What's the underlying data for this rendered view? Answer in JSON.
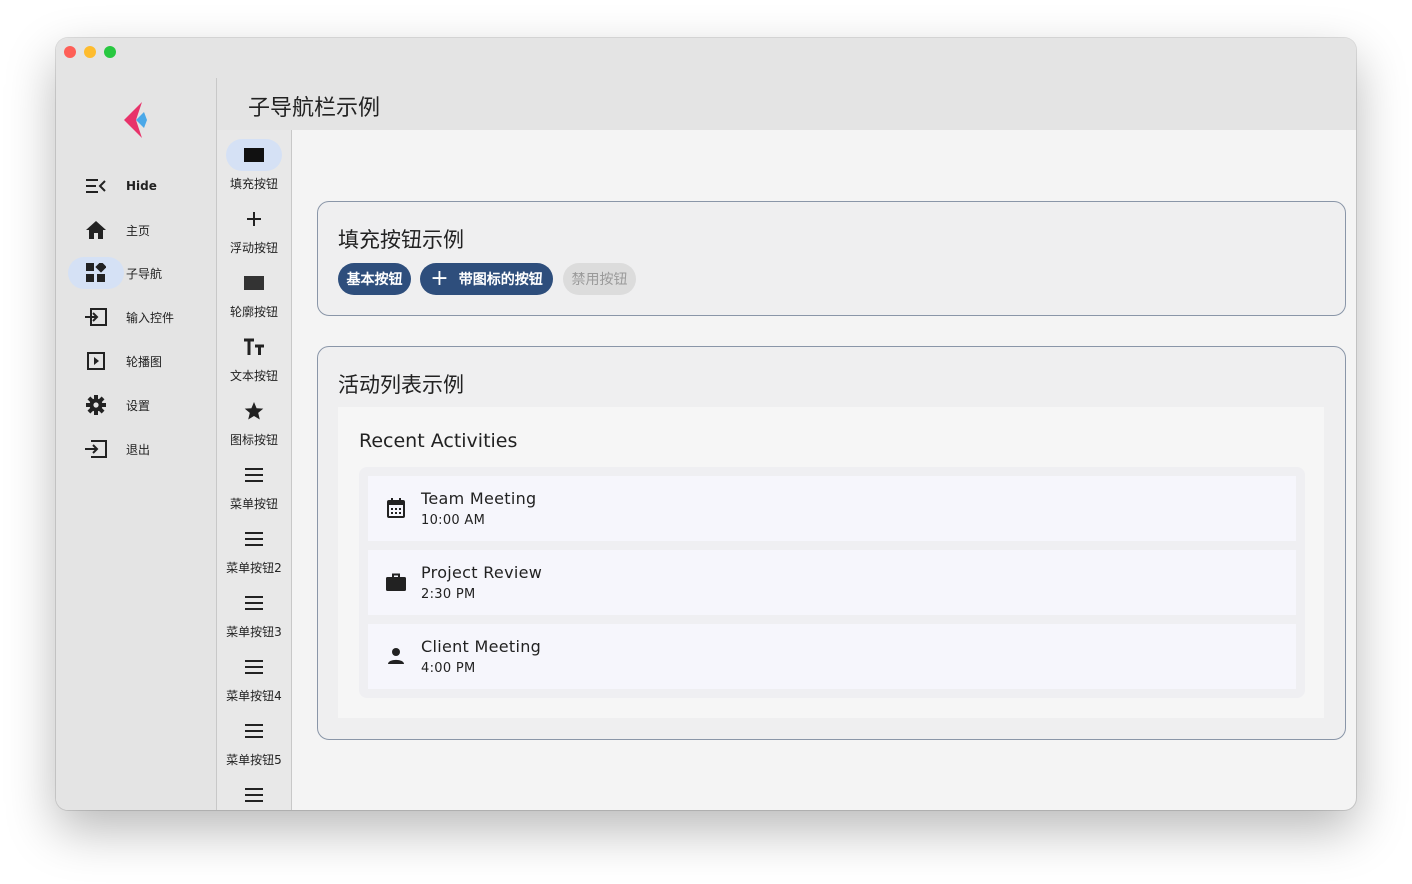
{
  "window": {
    "controls": [
      "close",
      "minimize",
      "maximize"
    ]
  },
  "rail": {
    "items": [
      {
        "label": "Hide",
        "icon": "menu-collapse-icon",
        "active": false
      },
      {
        "label": "主页",
        "icon": "home-icon",
        "active": false
      },
      {
        "label": "子导航",
        "icon": "dashboard-icon",
        "active": true
      },
      {
        "label": "输入控件",
        "icon": "input-icon",
        "active": false
      },
      {
        "label": "轮播图",
        "icon": "play-icon",
        "active": false
      },
      {
        "label": "设置",
        "icon": "gear-icon",
        "active": false
      },
      {
        "label": "退出",
        "icon": "logout-icon",
        "active": false
      }
    ]
  },
  "subnav": {
    "items": [
      {
        "label": "填充按钮",
        "icon": "filled-rect-icon",
        "active": true
      },
      {
        "label": "浮动按钮",
        "icon": "plus-icon",
        "active": false
      },
      {
        "label": "轮廓按钮",
        "icon": "rect-icon",
        "active": false
      },
      {
        "label": "文本按钮",
        "icon": "text-icon",
        "active": false
      },
      {
        "label": "图标按钮",
        "icon": "star-icon",
        "active": false
      },
      {
        "label": "菜单按钮",
        "icon": "menu-icon",
        "active": false
      },
      {
        "label": "菜单按钮2",
        "icon": "menu-icon",
        "active": false
      },
      {
        "label": "菜单按钮3",
        "icon": "menu-icon",
        "active": false
      },
      {
        "label": "菜单按钮4",
        "icon": "menu-icon",
        "active": false
      },
      {
        "label": "菜单按钮5",
        "icon": "menu-icon",
        "active": false
      },
      {
        "label": "",
        "icon": "menu-icon",
        "active": false
      }
    ]
  },
  "header": {
    "title": "子导航栏示例"
  },
  "filled_card": {
    "title": "填充按钮示例",
    "basic_label": "基本按钮",
    "icon_label": "带图标的按钮",
    "disabled_label": "禁用按钮"
  },
  "activity_card": {
    "title": "活动列表示例",
    "heading": "Recent Activities",
    "items": [
      {
        "title": "Team Meeting",
        "time": "10:00 AM",
        "icon": "calendar-icon"
      },
      {
        "title": "Project Review",
        "time": "2:30 PM",
        "icon": "briefcase-icon"
      },
      {
        "title": "Client Meeting",
        "time": "4:00 PM",
        "icon": "person-icon"
      }
    ]
  },
  "colors": {
    "primary": "#2e4e7c",
    "active_indicator": "#d5e1f5",
    "logo_red": "#e8336a",
    "logo_blue": "#4aa8e8"
  }
}
